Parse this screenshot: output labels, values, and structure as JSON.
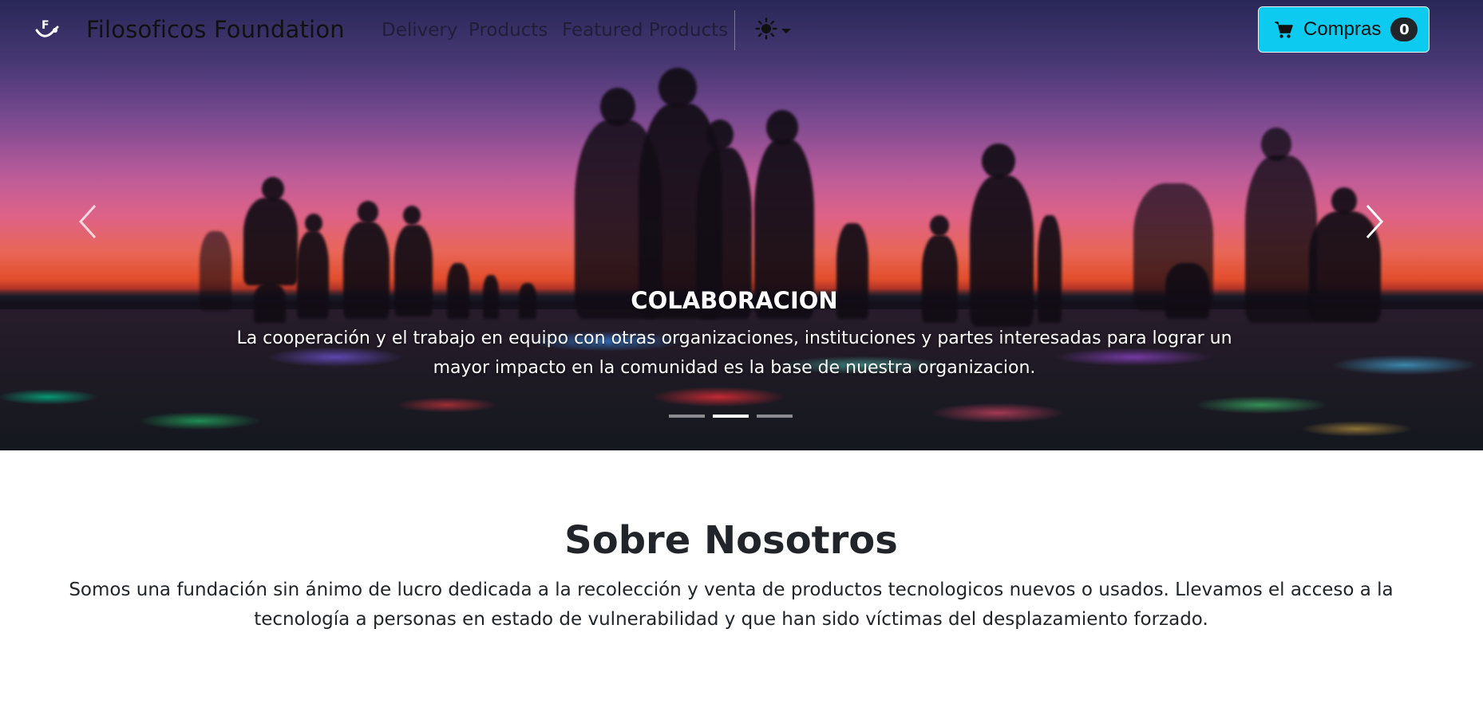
{
  "navbar": {
    "brand_name": "Filosoficos Foundation",
    "links": [
      "Delivery",
      "Products",
      "Featured Products"
    ],
    "theme_icon": "sun-icon",
    "cart": {
      "label": "Compras",
      "count": "0",
      "icon": "cart-icon",
      "color": "#0dcaf0"
    }
  },
  "hero": {
    "caption_title": "COLABORACION",
    "caption_text": "La cooperación y el trabajo en equipo con otras organizaciones, instituciones y partes interesadas para lograr un mayor impacto en la comunidad es la base de nuestra organizacion.",
    "indicators": 3,
    "active_indicator": 1
  },
  "about": {
    "title": "Sobre Nosotros",
    "text": "Somos una fundación sin ánimo de lucro dedicada a la recolección y venta de productos tecnologicos nuevos o usados. Llevamos el acceso a la tecnología a personas en estado de vulnerabilidad y que han sido víctimas del desplazamiento forzado."
  }
}
